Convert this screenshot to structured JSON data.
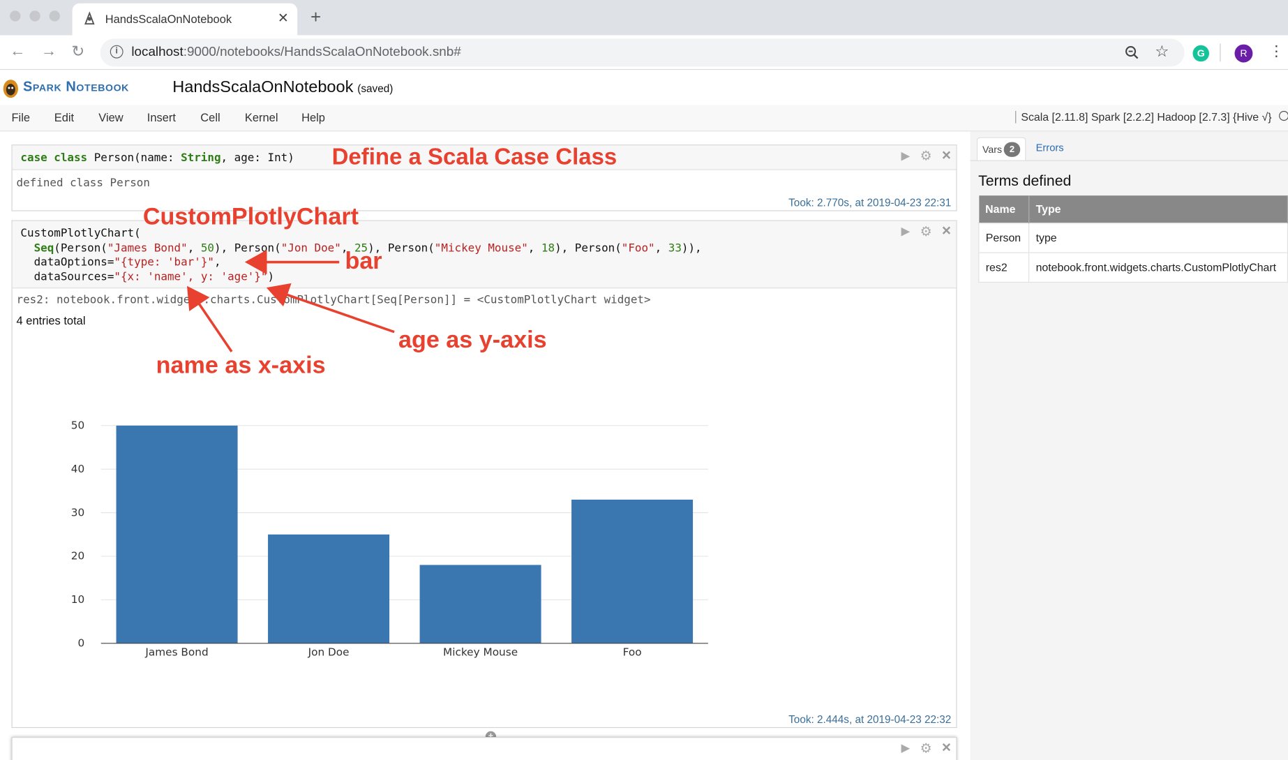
{
  "browser": {
    "tab_title": "HandsScalaOnNotebook",
    "url_host": "localhost",
    "url_path": ":9000/notebooks/HandsScalaOnNotebook.snb#",
    "profile_initial": "R",
    "extension_initial": "G"
  },
  "notebook": {
    "logo_text": "Spark Notebook",
    "title": "HandsScalaOnNotebook",
    "saved_label": "(saved)",
    "kernel_info": "Scala [2.11.8] Spark [2.2.2] Hadoop [2.7.3] {Hive √}"
  },
  "menu": [
    "File",
    "Edit",
    "View",
    "Insert",
    "Cell",
    "Kernel",
    "Help"
  ],
  "cell1": {
    "code": {
      "kw": "case class",
      "rest_a": " Person(name: ",
      "type1": "String",
      "rest_b": ", age: Int)"
    },
    "output": "defined class Person",
    "took": "Took: 2.770s, at 2019-04-23 22:31",
    "annotation": "Define a Scala Case Class"
  },
  "cell2": {
    "line1": "CustomPlotlyChart(",
    "seq": "Seq",
    "p1": "(Person(",
    "s_james": "\"James Bond\"",
    "n50": "50",
    "p2": "), Person(",
    "s_jon": "\"Jon Doe\"",
    "n25": "25",
    "p3": "), Person(",
    "s_mickey": "\"Mickey Mouse\"",
    "n18": "18",
    "p4": "), Person(",
    "s_foo": "\"Foo\"",
    "n33": "33",
    "p5": ")),",
    "comma": ", ",
    "opt_key": "dataOptions=",
    "opt_val": "\"{type: 'bar'}\"",
    "opt_end": ",",
    "src_key": "dataSources=",
    "src_val": "\"{x: 'name', y: 'age'}\"",
    "src_end": ")",
    "result": "res2: notebook.front.widgets.charts.CustomPlotlyChart[Seq[Person]] = <CustomPlotlyChart widget>",
    "entries": "4 entries total",
    "took": "Took: 2.444s, at 2019-04-23 22:32",
    "ann_chart": "CustomPlotlyChart",
    "ann_bar": "bar",
    "ann_y": "age as y-axis",
    "ann_x": "name as x-axis"
  },
  "chart_data": {
    "type": "bar",
    "categories": [
      "James Bond",
      "Jon Doe",
      "Mickey Mouse",
      "Foo"
    ],
    "values": [
      50,
      25,
      18,
      33
    ],
    "yticks": [
      "0",
      "10",
      "20",
      "30",
      "40",
      "50"
    ],
    "ylim": [
      0,
      50
    ],
    "color": "#3a77b0",
    "grid": true,
    "title": "",
    "xlabel": "",
    "ylabel": ""
  },
  "side": {
    "tab_vars": "Vars",
    "vars_count": "2",
    "tab_errors": "Errors",
    "terms_heading": "Terms defined",
    "headers": [
      "Name",
      "Type"
    ],
    "rows": [
      {
        "name": "Person",
        "type": "type"
      },
      {
        "name": "res2",
        "type": "notebook.front.widgets.charts.CustomPlotlyChart"
      }
    ]
  },
  "colors": {
    "accent": "#2f6eaf",
    "annotation": "#e8412f",
    "bar": "#3a77b0"
  }
}
